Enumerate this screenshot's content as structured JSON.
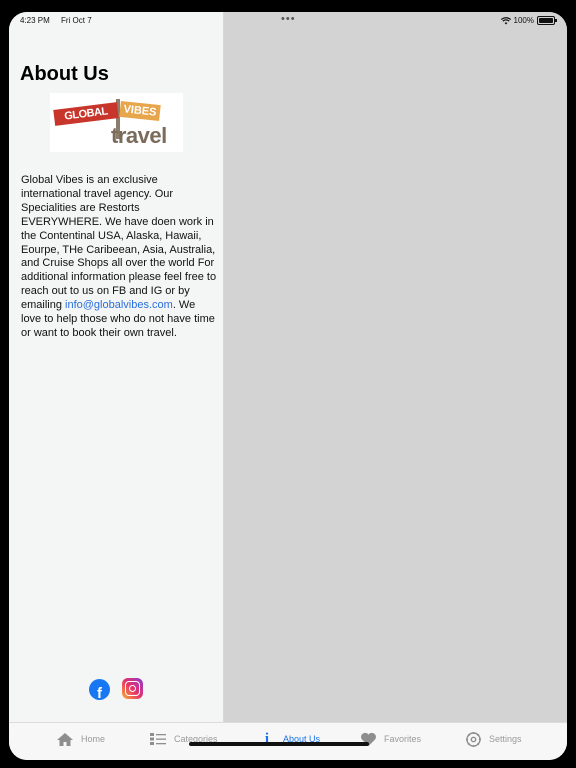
{
  "status": {
    "time": "4:23 PM",
    "date": "Fri Oct 7",
    "battery": "100%"
  },
  "about": {
    "title": "About Us",
    "logo": {
      "word1": "GLOBAL",
      "word2": "VIBES",
      "word3": "travel"
    },
    "text_before_link": "Global Vibes is an exclusive international travel agency.  Our Specialities are Restorts EVERYWHERE.  We have doen work in the Contentinal USA, Alaska, Hawaii, Eourpe, THe Caribeean, Asia, Australia, and Cruise Shops all over the world  For additional information please feel free to reach out to us on FB and IG or by emailing ",
    "email": "info@globalvibes.com",
    "text_after_link": ".  We love to help those who do not have time or want to book their own travel."
  },
  "social": {
    "facebook_icon": "facebook-icon",
    "instagram_icon": "instagram-icon"
  },
  "tabs": [
    {
      "label": "Home",
      "icon": "house-icon",
      "active": false
    },
    {
      "label": "Categories",
      "icon": "list-icon",
      "active": false
    },
    {
      "label": "About Us",
      "icon": "info-icon",
      "active": true
    },
    {
      "label": "Favorites",
      "icon": "heart-icon",
      "active": false
    },
    {
      "label": "Settings",
      "icon": "gear-icon",
      "active": false
    }
  ],
  "colors": {
    "accent": "#1a73e8",
    "link": "#2a6fdb",
    "detail_background": "#d3d3d3"
  }
}
